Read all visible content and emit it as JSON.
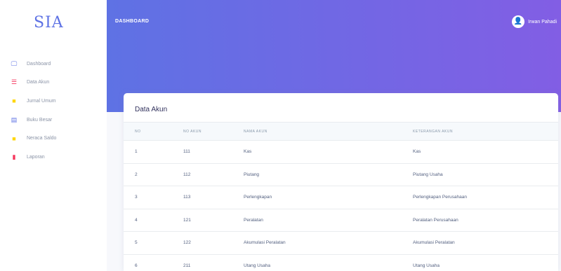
{
  "brand": {
    "logo_text": "SIA",
    "header_title": "DASHBOARD"
  },
  "user": {
    "name": "Irwan Pahadi"
  },
  "sidebar": {
    "items": [
      {
        "label": "Dashboard",
        "icon": "monitor-icon",
        "color": "#5e72e4"
      },
      {
        "label": "Data Akun",
        "icon": "list-icon",
        "color": "#f5365c"
      },
      {
        "label": "Jurnal Umum",
        "icon": "book-icon",
        "color": "#ffd600"
      },
      {
        "label": "Buku Besar",
        "icon": "ledger-icon",
        "color": "#5e72e4"
      },
      {
        "label": "Neraca Saldo",
        "icon": "scale-icon",
        "color": "#ffd600"
      },
      {
        "label": "Laporan",
        "icon": "report-icon",
        "color": "#f5365c"
      }
    ]
  },
  "card": {
    "title": "Data Akun"
  },
  "table": {
    "headers": [
      "NO",
      "NO AKUN",
      "NAMA AKUN",
      "KETERANGAN AKUN"
    ],
    "rows": [
      [
        "1",
        "111",
        "Kas",
        "Kas"
      ],
      [
        "2",
        "112",
        "Piutang",
        "Piutang Usaha"
      ],
      [
        "3",
        "113",
        "Perlengkapan",
        "Perlengkapan Perusahaan"
      ],
      [
        "4",
        "121",
        "Peralatan",
        "Peralatan Perusahaan"
      ],
      [
        "5",
        "122",
        "Akumulasi Peralatan",
        "Akumulasi Peralatan"
      ],
      [
        "6",
        "211",
        "Utang Usaha",
        "Utang Usaha"
      ]
    ]
  },
  "colors": {
    "gradient_start": "#5e72e4",
    "gradient_end": "#825ee4",
    "primary": "#5e72e4",
    "danger": "#f5365c",
    "warning": "#ffd600"
  }
}
